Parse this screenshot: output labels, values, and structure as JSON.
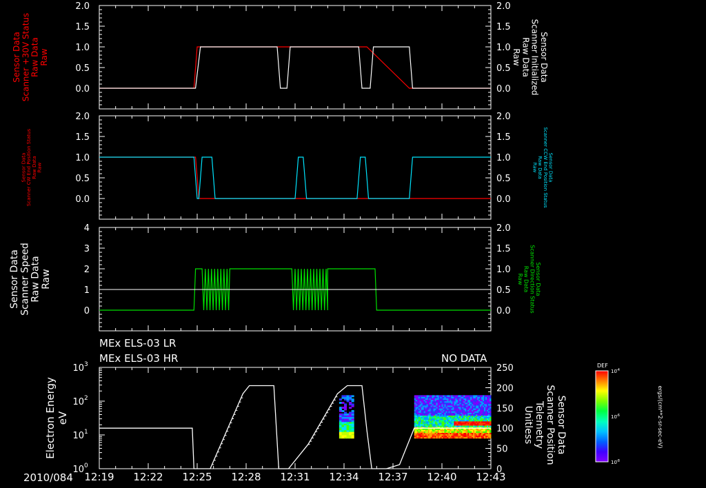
{
  "colors": {
    "background": "#000000",
    "axis": "#ffffff",
    "red": "#ff0000",
    "cyan": "#00e5ff",
    "green": "#00e000",
    "white": "#ffffff"
  },
  "panel1": {
    "left_label_lines": [
      "Sensor Data",
      "Scanner +30V Status",
      "Raw Data",
      "Raw"
    ],
    "right_label_lines": [
      "Sensor Data",
      "Scanner Initialized",
      "Raw Data",
      "Raw"
    ],
    "left_ticks": [
      "2.0",
      "1.5",
      "1.0",
      "0.5",
      "0.0"
    ],
    "right_ticks": [
      "2.0",
      "1.5",
      "1.0",
      "0.5",
      "0.0"
    ]
  },
  "panel2": {
    "left_label_lines": [
      "Sensor Data",
      "Scanner CW End Position Status",
      "Raw Data",
      "Raw"
    ],
    "right_label_lines": [
      "Sensor Data",
      "Scanner CCW End Position Status",
      "Raw Data",
      "Raw"
    ],
    "left_ticks": [
      "2.0",
      "1.5",
      "1.0",
      "0.5",
      "0.0"
    ],
    "right_ticks": [
      "2.0",
      "1.5",
      "1.0",
      "0.5",
      "0.0"
    ]
  },
  "panel3": {
    "left_label_lines": [
      "Sensor Data",
      "Scanner Speed",
      "Raw Data",
      "Raw"
    ],
    "right_label_lines": [
      "Sensor Data",
      "Scanner Direction Status",
      "Raw Data",
      "Raw"
    ],
    "left_ticks": [
      "4",
      "3",
      "2",
      "1",
      "0"
    ],
    "right_ticks": [
      "2.0",
      "1.5",
      "1.0",
      "0.5",
      "0.0"
    ]
  },
  "panel4": {
    "header_line1": "MEx ELS-03 LR",
    "header_line2": "MEx ELS-03 HR",
    "no_data": "NO DATA",
    "left_label_lines": [
      "Electron Energy",
      "eV"
    ],
    "right_label_lines": [
      "Sensor Data",
      "Scanner Position",
      "Telemetry",
      "Unitless"
    ],
    "left_ticks": [
      "10",
      "10",
      "10",
      "10"
    ],
    "left_tick_exps": [
      "3",
      "2",
      "1",
      "0"
    ],
    "right_ticks": [
      "250",
      "200",
      "150",
      "100",
      "50",
      "0"
    ],
    "colorbar_title": "DEF",
    "colorbar_ticks": [
      "10",
      "10",
      "10"
    ],
    "colorbar_exps": [
      "-4",
      "-6",
      "-8"
    ],
    "colorbar_units": "ergs/(cm**2-sr-sec-eV)"
  },
  "xaxis": {
    "date_label": "2010/084",
    "ticks": [
      "12:19",
      "12:22",
      "12:25",
      "12:28",
      "12:31",
      "12:34",
      "12:37",
      "12:40",
      "12:43"
    ]
  },
  "chart_data": [
    {
      "type": "line",
      "panel": "panel1",
      "x_range": [
        "12:19",
        "12:43"
      ],
      "ylim": [
        -0.5,
        2.0
      ],
      "series": [
        {
          "color": "red",
          "x": [
            "12:19",
            "12:24.8",
            "12:25.0",
            "12:30.0",
            "12:30.2",
            "12:30.6",
            "12:31.0",
            "12:34.8",
            "12:35.4",
            "12:38.0",
            "12:43"
          ],
          "y": [
            0,
            0,
            1,
            1,
            1,
            1,
            1,
            1,
            1,
            0,
            0
          ]
        },
        {
          "color": "white",
          "x": [
            "12:19",
            "12:24.9",
            "12:25.2",
            "12:29.9",
            "12:30.1",
            "12:30.5",
            "12:30.7",
            "12:34.9",
            "12:35.1",
            "12:35.6",
            "12:35.8",
            "12:38.0",
            "12:38.2",
            "12:43"
          ],
          "y": [
            0,
            0,
            1,
            1,
            0,
            0,
            1,
            1,
            0,
            0,
            1,
            1,
            0,
            0
          ]
        }
      ]
    },
    {
      "type": "line",
      "panel": "panel2",
      "x_range": [
        "12:19",
        "12:43"
      ],
      "ylim": [
        -0.5,
        2.0
      ],
      "series": [
        {
          "color": "red",
          "x": [
            "12:19",
            "12:24.9",
            "12:25.1",
            "12:26.3",
            "12:43"
          ],
          "y": [
            1,
            1,
            0,
            0,
            0
          ]
        },
        {
          "color": "cyan",
          "x": [
            "12:19",
            "12:24.8",
            "12:25.0",
            "12:25.1",
            "12:25.3",
            "12:25.9",
            "12:26.1",
            "12:31.0",
            "12:31.2",
            "12:31.5",
            "12:31.7",
            "12:34.8",
            "12:35.0",
            "12:35.3",
            "12:35.5",
            "12:38.0",
            "12:38.2",
            "12:43"
          ],
          "y": [
            1,
            1,
            0,
            0,
            1,
            1,
            0,
            0,
            1,
            1,
            0,
            0,
            1,
            1,
            0,
            0,
            1,
            1
          ]
        }
      ]
    },
    {
      "type": "line",
      "panel": "panel3",
      "x_range": [
        "12:19",
        "12:43"
      ],
      "ylim": [
        -1,
        4
      ],
      "series": [
        {
          "name": "speed",
          "color": "green",
          "values_desc": "0 until 12:24.8, 2 until 12:25.3, oscillating 0-2 until 12:27.0, 2 until 12:30.9, oscillating 0-2 until 12:33.0, 2 until 12:35.9, 0 after"
        },
        {
          "name": "direction",
          "color": "white",
          "constant": 0.5
        }
      ]
    },
    {
      "type": "heatmap",
      "panel": "panel4",
      "x_range": [
        "12:19",
        "12:43"
      ],
      "ylim": [
        1,
        1000
      ],
      "ylog": true,
      "right_ylim": [
        0,
        250
      ],
      "scanner_position_line": {
        "color": "white",
        "x": [
          "12:19",
          "12:24.7",
          "12:24.8",
          "12:25.8",
          "12:27.8",
          "12:28.2",
          "12:29.7",
          "12:30.0",
          "12:30.3",
          "12:30.6",
          "12:31.8",
          "12:33.6",
          "12:34.2",
          "12:35.1",
          "12:35.4",
          "12:35.7",
          "12:36.6",
          "12:37.4",
          "12:38.3",
          "12:43"
        ],
        "y": [
          100,
          100,
          0,
          0,
          185,
          205,
          205,
          0,
          0,
          0,
          60,
          185,
          205,
          205,
          95,
          0,
          0,
          10,
          100,
          100
        ]
      },
      "spectra_regions": [
        {
          "x": [
            "12:33.7",
            "12:34.6"
          ],
          "energy_range": [
            8,
            130
          ]
        },
        {
          "x": [
            "12:38.3",
            "12:43"
          ],
          "energy_range": [
            8,
            150
          ]
        }
      ]
    }
  ]
}
